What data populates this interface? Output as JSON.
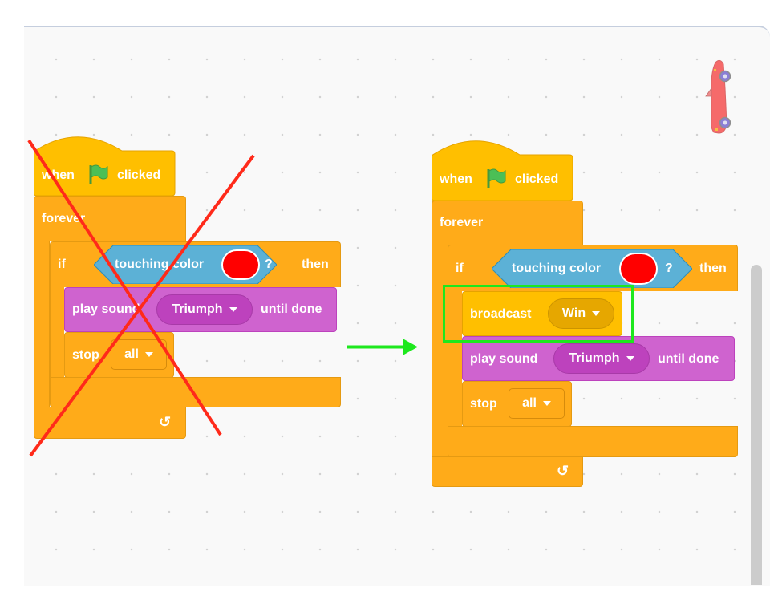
{
  "workspace": {
    "background": "#f9f9f9",
    "sprite_icon": "red-convertible-car-icon"
  },
  "annotations": {
    "cross_color": "#ff2a1a",
    "arrow_color": "#1ee81e",
    "highlight_color": "#1ee81e",
    "old_script_state": "crossed-out",
    "new_script_highlight": "broadcast block"
  },
  "scripts": {
    "old": {
      "hat": {
        "when": "when",
        "flag_icon": "green-flag-icon",
        "clicked": "clicked"
      },
      "forever": {
        "label": "forever",
        "loop_icon": "loop-arrow-icon"
      },
      "if_block": {
        "if": "if",
        "condition": {
          "label": "touching color",
          "color_value": "#ff0000",
          "question": "?"
        },
        "then": "then"
      },
      "play_sound": {
        "label": "play sound",
        "sound": "Triumph",
        "suffix": "until done"
      },
      "stop": {
        "label": "stop",
        "option": "all"
      }
    },
    "new": {
      "hat": {
        "when": "when",
        "flag_icon": "green-flag-icon",
        "clicked": "clicked"
      },
      "forever": {
        "label": "forever",
        "loop_icon": "loop-arrow-icon"
      },
      "if_block": {
        "if": "if",
        "condition": {
          "label": "touching color",
          "color_value": "#ff0000",
          "question": "?"
        },
        "then": "then"
      },
      "broadcast": {
        "label": "broadcast",
        "message": "Win"
      },
      "play_sound": {
        "label": "play sound",
        "sound": "Triumph",
        "suffix": "until done"
      },
      "stop": {
        "label": "stop",
        "option": "all"
      }
    }
  }
}
